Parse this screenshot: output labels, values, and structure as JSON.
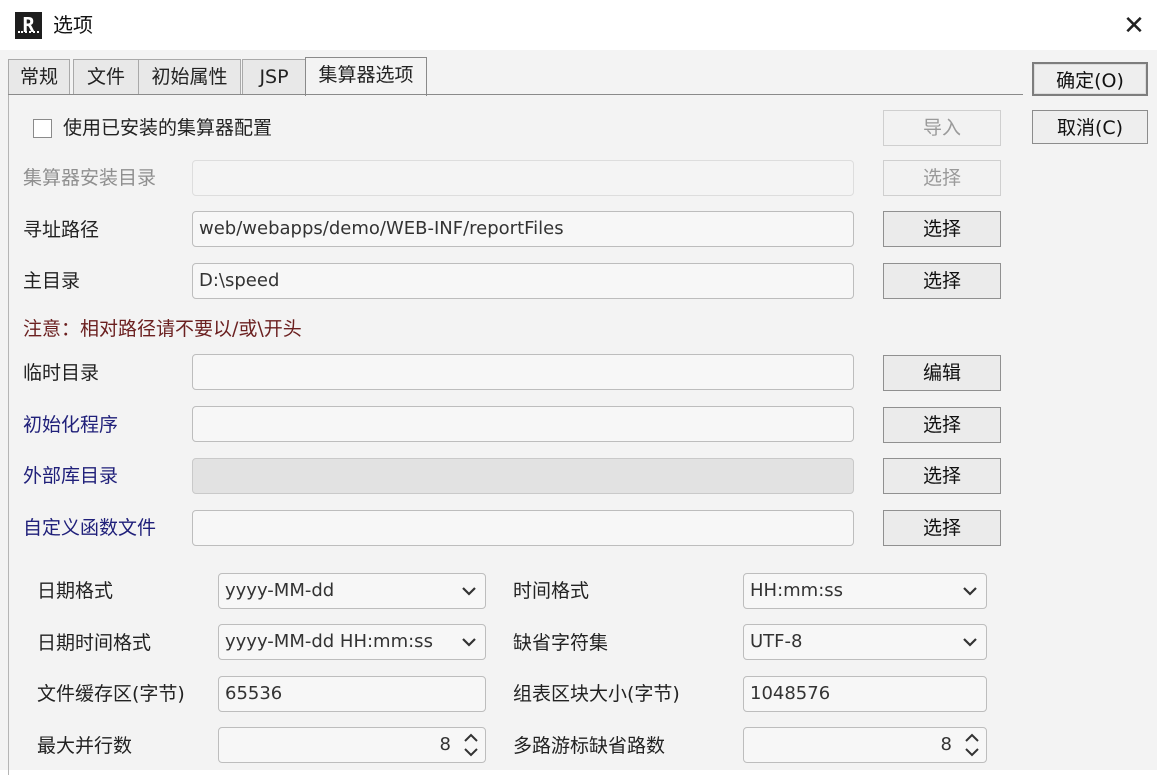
{
  "window": {
    "title": "选项",
    "close_glyph": "✕",
    "app_icon_letter": "R"
  },
  "tabs": [
    {
      "label": "常规"
    },
    {
      "label": "文件"
    },
    {
      "label": "初始属性"
    },
    {
      "label": "JSP"
    },
    {
      "label": "集算器选项",
      "active": true
    }
  ],
  "side_buttons": {
    "ok": "确定(O)",
    "cancel": "取消(C)"
  },
  "use_installed": {
    "label": "使用已安装的集算器配置",
    "checked": false,
    "import_label": "导入"
  },
  "rows": {
    "install_dir": {
      "label": "集算器安装目录",
      "value": "",
      "button": "选择"
    },
    "search_path": {
      "label": "寻址路径",
      "value": "web/webapps/demo/WEB-INF/reportFiles",
      "button": "选择"
    },
    "main_dir": {
      "label": "主目录",
      "value": "D:\\speed",
      "button": "选择"
    },
    "note": "注意：相对路径请不要以/或\\开头",
    "temp_dir": {
      "label": "临时目录",
      "value": "",
      "button": "编辑"
    },
    "init_program": {
      "label": "初始化程序",
      "value": "",
      "button": "选择"
    },
    "ext_lib_dir": {
      "label": "外部库目录",
      "value": "",
      "button": "选择"
    },
    "custom_func_file": {
      "label": "自定义函数文件",
      "value": "",
      "button": "选择"
    }
  },
  "settings": {
    "date_format": {
      "label": "日期格式",
      "value": "yyyy-MM-dd"
    },
    "time_format": {
      "label": "时间格式",
      "value": "HH:mm:ss"
    },
    "datetime_format": {
      "label": "日期时间格式",
      "value": "yyyy-MM-dd HH:mm:ss"
    },
    "default_charset": {
      "label": "缺省字符集",
      "value": "UTF-8"
    },
    "file_buffer": {
      "label": "文件缓存区(字节)",
      "value": "65536"
    },
    "block_size": {
      "label": "组表区块大小(字节)",
      "value": "1048576"
    },
    "max_parallel": {
      "label": "最大并行数",
      "value": "8"
    },
    "cursor_paths": {
      "label": "多路游标缺省路数",
      "value": "8"
    }
  },
  "colors": {
    "blue_label": "#20207a",
    "note": "#6b2020",
    "disabled": "#8f8f8f"
  },
  "icons": {
    "combo": "chevron-down-icon",
    "spinner": "spinner-arrows-icon",
    "close": "close-icon",
    "app": "app-icon"
  }
}
